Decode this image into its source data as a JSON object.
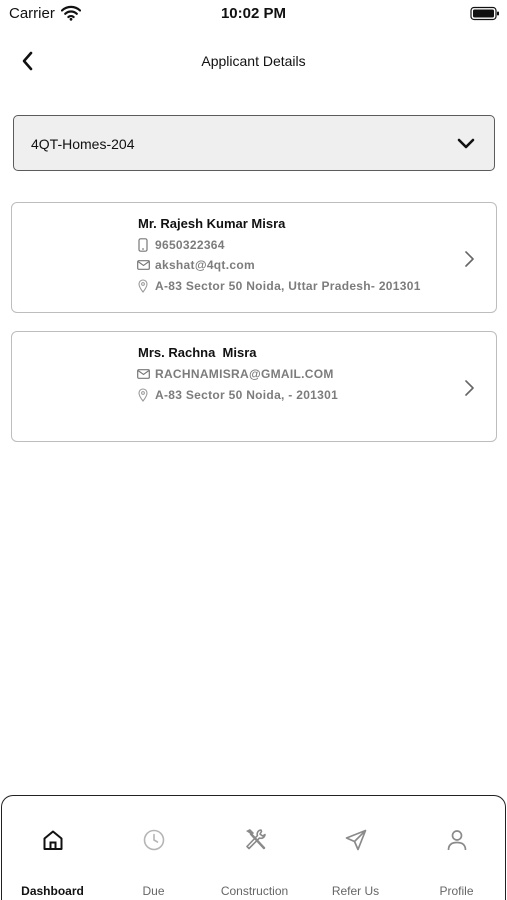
{
  "status_bar": {
    "carrier": "Carrier",
    "time": "10:02 PM"
  },
  "nav": {
    "title": "Applicant Details"
  },
  "unit_select": {
    "value": "4QT-Homes-204"
  },
  "applicants": [
    {
      "name": "Mr. Rajesh Kumar Misra",
      "phone": "9650322364",
      "email": "akshat@4qt.com",
      "address": "A-83 Sector 50 Noida, Uttar Pradesh- 201301"
    },
    {
      "name": "Mrs. Rachna  Misra",
      "email": "RACHNAMISRA@GMAIL.COM",
      "address": "A-83 Sector 50 Noida, - 201301"
    }
  ],
  "tabs": [
    {
      "label": "Dashboard",
      "icon": "home-icon",
      "active": true
    },
    {
      "label": "Due",
      "icon": "clock-icon",
      "active": false
    },
    {
      "label": "Construction",
      "icon": "tools-icon",
      "active": false
    },
    {
      "label": "Refer Us",
      "icon": "send-icon",
      "active": false
    },
    {
      "label": "Profile",
      "icon": "user-icon",
      "active": false
    }
  ],
  "colors": {
    "active": "#111111",
    "inactive": "#8a8a8a",
    "secondary_text": "#7c7c7c"
  }
}
